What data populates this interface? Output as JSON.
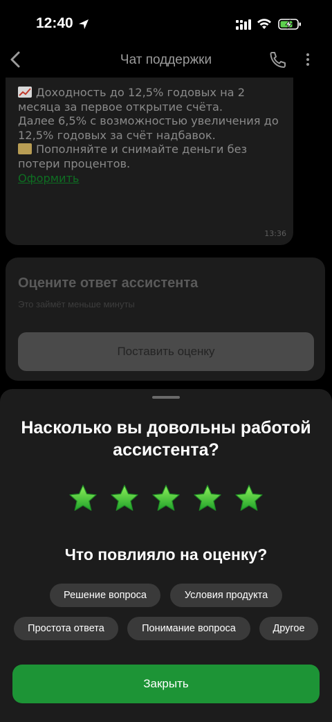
{
  "status_bar": {
    "time": "12:40"
  },
  "chat": {
    "title": "Чат поддержки",
    "message": {
      "line1": "Доходность до 12,5% годовых на 2 месяца за первое открытие счёта.",
      "line2": "Далее 6,5% с возможностью увеличения до 12,5% годовых за счёт надбавок.",
      "line3": "Пополняйте и снимайте деньги без потери процентов.",
      "link": "Оформить",
      "time": "13:36"
    }
  },
  "rating_card": {
    "title": "Оцените ответ ассистента",
    "subtitle": "Это займёт меньше минуты",
    "button_label": "Поставить оценку"
  },
  "sheet": {
    "title": "Насколько вы довольны работой ассистента?",
    "rating": {
      "value": 5,
      "max": 5
    },
    "question": "Что повлияло на оценку?",
    "chips": [
      "Решение вопроса",
      "Условия продукта",
      "Простота ответа",
      "Понимание вопроса",
      "Другое"
    ],
    "close_label": "Закрыть"
  },
  "colors": {
    "accent": "#1d9436",
    "star": "#5bd12f",
    "sheet_bg": "#1c1c1c"
  }
}
